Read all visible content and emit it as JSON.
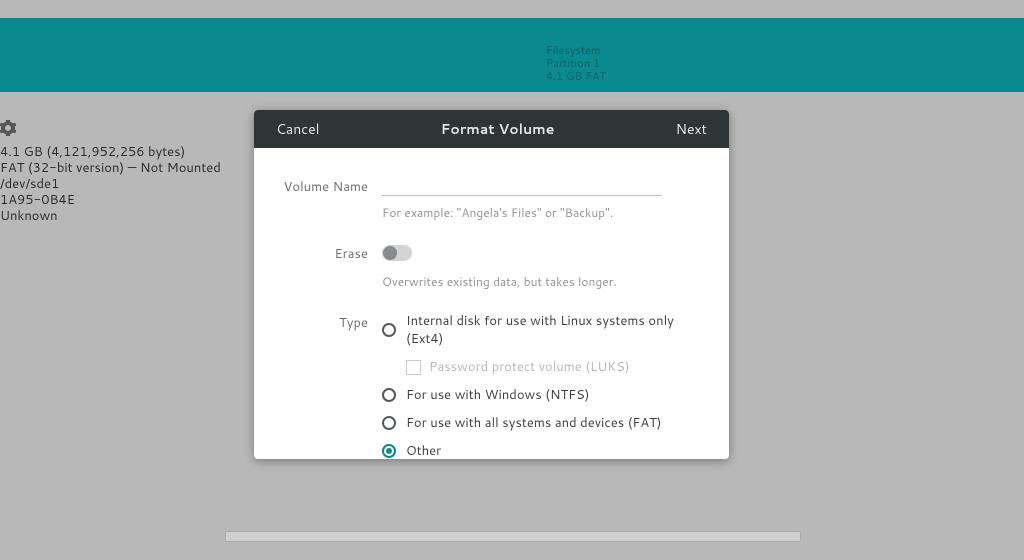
{
  "banner": {
    "line1": "Filesystem",
    "line2": "Partition 1",
    "line3": "4.1 GB FAT"
  },
  "props": {
    "size": "4.1 GB (4,121,952,256 bytes)",
    "fs": "FAT (32-bit version) — Not Mounted",
    "device": "/dev/sde1",
    "uuid": "1A95-0B4E",
    "partition": "Unknown"
  },
  "dialog": {
    "cancel": "Cancel",
    "title": "Format Volume",
    "next": "Next",
    "volume_name_label": "Volume Name",
    "volume_name_hint": "For example: \"Angela's Files\" or \"Backup\".",
    "erase_label": "Erase",
    "erase_hint": "Overwrites existing data, but takes longer.",
    "type_label": "Type",
    "type_options": {
      "ext4": "Internal disk for use with Linux systems only (Ext4)",
      "luks": "Password protect volume (LUKS)",
      "ntfs": "For use with Windows (NTFS)",
      "fat": "For use with all systems and devices (FAT)",
      "other": "Other"
    }
  }
}
